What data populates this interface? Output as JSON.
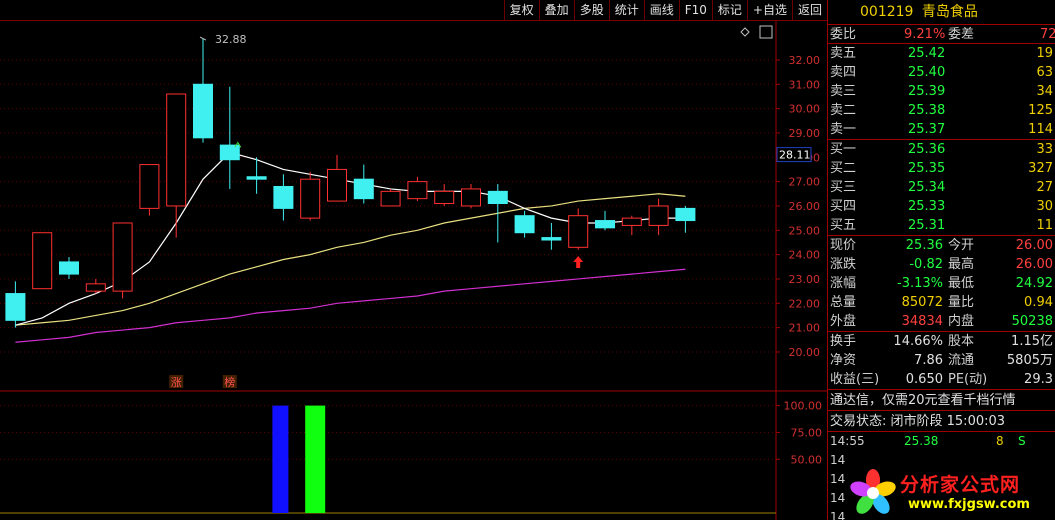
{
  "toolbar": {
    "buttons": [
      "复权",
      "叠加",
      "多股",
      "统计",
      "画线",
      "F10",
      "标记",
      "+自选",
      "返回"
    ]
  },
  "stock": {
    "code": "001219",
    "name": "青岛食品"
  },
  "quote": {
    "ratio": {
      "label": "委比",
      "value": "9.21%",
      "label2": "委差",
      "value2": "72"
    },
    "asks": [
      {
        "label": "卖五",
        "price": "25.42",
        "vol": "19"
      },
      {
        "label": "卖四",
        "price": "25.40",
        "vol": "63"
      },
      {
        "label": "卖三",
        "price": "25.39",
        "vol": "34"
      },
      {
        "label": "卖二",
        "price": "25.38",
        "vol": "125"
      },
      {
        "label": "卖一",
        "price": "25.37",
        "vol": "114"
      }
    ],
    "bids": [
      {
        "label": "买一",
        "price": "25.36",
        "vol": "33"
      },
      {
        "label": "买二",
        "price": "25.35",
        "vol": "327"
      },
      {
        "label": "买三",
        "price": "25.34",
        "vol": "27"
      },
      {
        "label": "买四",
        "price": "25.33",
        "vol": "30"
      },
      {
        "label": "买五",
        "price": "25.31",
        "vol": "11"
      }
    ],
    "stats": [
      {
        "l1": "现价",
        "v1": "25.36",
        "l2": "今开",
        "v2": "26.00",
        "c1": "green",
        "c2": "red"
      },
      {
        "l1": "涨跌",
        "v1": "-0.82",
        "l2": "最高",
        "v2": "26.00",
        "c1": "green",
        "c2": "red"
      },
      {
        "l1": "涨幅",
        "v1": "-3.13%",
        "l2": "最低",
        "v2": "24.92",
        "c1": "green",
        "c2": "green"
      },
      {
        "l1": "总量",
        "v1": "85072",
        "l2": "量比",
        "v2": "0.94",
        "c1": "yellow",
        "c2": "yellow"
      },
      {
        "l1": "外盘",
        "v1": "34834",
        "l2": "内盘",
        "v2": "50238",
        "c1": "red",
        "c2": "green"
      }
    ],
    "fund": [
      {
        "l1": "换手",
        "v1": "14.66%",
        "l2": "股本",
        "v2": "1.15亿"
      },
      {
        "l1": "净资",
        "v1": "7.86",
        "l2": "流通",
        "v2": "5805万"
      },
      {
        "l1": "收益(三)",
        "v1": "0.650",
        "l2": "PE(动)",
        "v2": "29.3"
      }
    ],
    "notice": "通达信，仅需20元查看千档行情",
    "status": "交易状态: 闭市阶段 15:00:03",
    "ticks": [
      {
        "time": "14:55",
        "price": "25.38",
        "vol": "8",
        "side": "S"
      },
      {
        "time": "14",
        "price": "",
        "vol": "",
        "side": ""
      },
      {
        "time": "14",
        "price": "",
        "vol": "",
        "side": ""
      },
      {
        "time": "14",
        "price": "",
        "vol": "",
        "side": ""
      },
      {
        "time": "14",
        "price": "",
        "vol": "",
        "side": ""
      },
      {
        "time": "14",
        "price": "",
        "vol": "",
        "side": ""
      }
    ]
  },
  "watermark": {
    "cn": "分析家公式网",
    "url": "www.fxjgsw.com"
  },
  "chart_data": {
    "type": "candlestick",
    "price_axis": {
      "ticks": [
        32.0,
        31.0,
        30.0,
        29.0,
        28.0,
        27.0,
        26.0,
        25.0,
        24.0,
        23.0,
        22.0,
        21.0,
        20.0
      ],
      "ylim": [
        19.3,
        33.6
      ]
    },
    "current_price_marker": "28.11",
    "high_annotation": "32.88",
    "candles": [
      {
        "o": 22.4,
        "c": 21.3,
        "h": 22.9,
        "l": 21.0
      },
      {
        "o": 22.6,
        "c": 24.9,
        "h": 24.9,
        "l": 22.6
      },
      {
        "o": 23.7,
        "c": 23.2,
        "h": 23.9,
        "l": 23.0
      },
      {
        "o": 22.5,
        "c": 22.8,
        "h": 23.0,
        "l": 22.4
      },
      {
        "o": 22.5,
        "c": 25.3,
        "h": 25.3,
        "l": 22.2
      },
      {
        "o": 25.9,
        "c": 27.7,
        "h": 27.7,
        "l": 25.6
      },
      {
        "o": 26.0,
        "c": 30.6,
        "h": 30.6,
        "l": 24.7
      },
      {
        "o": 31.0,
        "c": 28.8,
        "h": 32.9,
        "l": 28.6
      },
      {
        "o": 28.5,
        "c": 27.9,
        "h": 30.9,
        "l": 26.7
      },
      {
        "o": 27.2,
        "c": 27.1,
        "h": 28.0,
        "l": 26.5
      },
      {
        "o": 26.8,
        "c": 25.9,
        "h": 27.3,
        "l": 25.4
      },
      {
        "o": 25.5,
        "c": 27.1,
        "h": 27.4,
        "l": 25.4
      },
      {
        "o": 26.2,
        "c": 27.5,
        "h": 28.1,
        "l": 26.2
      },
      {
        "o": 27.1,
        "c": 26.3,
        "h": 27.7,
        "l": 26.1
      },
      {
        "o": 26.0,
        "c": 26.6,
        "h": 26.7,
        "l": 26.0
      },
      {
        "o": 26.3,
        "c": 27.0,
        "h": 27.2,
        "l": 26.2
      },
      {
        "o": 26.1,
        "c": 26.6,
        "h": 26.9,
        "l": 26.0
      },
      {
        "o": 26.0,
        "c": 26.7,
        "h": 26.9,
        "l": 25.9
      },
      {
        "o": 26.6,
        "c": 26.1,
        "h": 26.9,
        "l": 24.5
      },
      {
        "o": 25.6,
        "c": 24.9,
        "h": 25.8,
        "l": 24.7
      },
      {
        "o": 24.7,
        "c": 24.6,
        "h": 25.3,
        "l": 24.2
      },
      {
        "o": 24.3,
        "c": 25.6,
        "h": 25.9,
        "l": 24.2
      },
      {
        "o": 25.4,
        "c": 25.1,
        "h": 25.8,
        "l": 25.0
      },
      {
        "o": 25.2,
        "c": 25.5,
        "h": 25.6,
        "l": 24.8
      },
      {
        "o": 25.2,
        "c": 26.0,
        "h": 26.3,
        "l": 24.8
      },
      {
        "o": 25.9,
        "c": 25.4,
        "h": 26.0,
        "l": 24.9
      }
    ],
    "ma_white": [
      21.1,
      21.4,
      22.0,
      22.4,
      22.9,
      23.7,
      25.3,
      27.1,
      28.2,
      27.9,
      27.5,
      27.3,
      27.1,
      26.9,
      26.7,
      26.6,
      26.6,
      26.6,
      26.4,
      25.9,
      25.5,
      25.3,
      25.3,
      25.4,
      25.5,
      25.5
    ],
    "ma_yellow": [
      21.1,
      21.2,
      21.3,
      21.5,
      21.7,
      22.0,
      22.4,
      22.8,
      23.2,
      23.5,
      23.8,
      24.0,
      24.3,
      24.5,
      24.8,
      25.0,
      25.3,
      25.5,
      25.7,
      25.9,
      26.0,
      26.2,
      26.3,
      26.4,
      26.5,
      26.4
    ],
    "ma_magenta": [
      20.4,
      20.5,
      20.6,
      20.8,
      20.9,
      21.0,
      21.2,
      21.3,
      21.4,
      21.6,
      21.7,
      21.8,
      22.0,
      22.1,
      22.2,
      22.3,
      22.5,
      22.6,
      22.7,
      22.8,
      22.9,
      23.0,
      23.1,
      23.2,
      23.3,
      23.4
    ],
    "labels": [
      {
        "text": "涨",
        "index": 6
      },
      {
        "text": "榜",
        "index": 8
      }
    ],
    "indicator": {
      "ticks": [
        100.0,
        75.0,
        50.0
      ],
      "ylim": [
        0,
        108
      ],
      "bars": [
        {
          "index": 10,
          "value": 100,
          "color": "#1010ff"
        },
        {
          "index": 11,
          "value": 100,
          "color": "#10ff10"
        }
      ]
    }
  }
}
